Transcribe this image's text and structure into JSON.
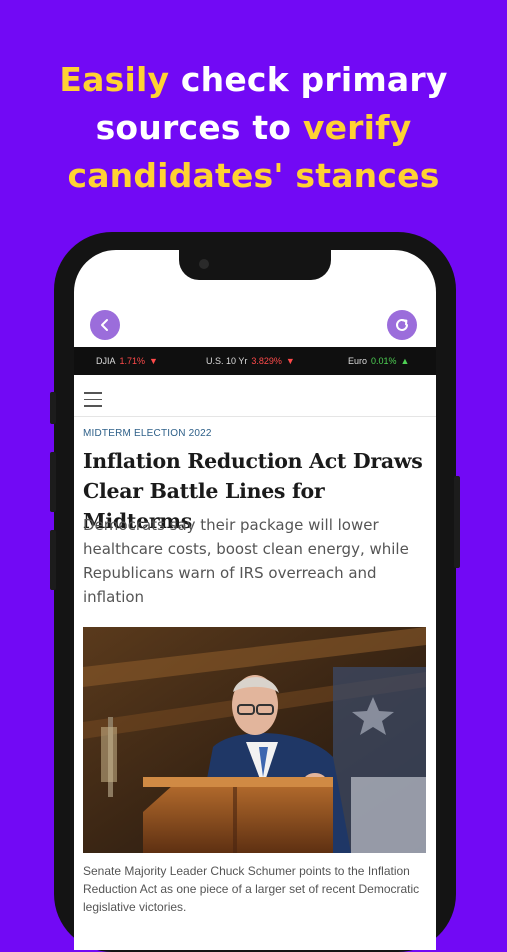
{
  "promo": {
    "line1_accent": "Easily",
    "line1_rest": " check primary",
    "line2_rest": "sources to ",
    "line2_accent": "verify",
    "line3_accent": "candidates' stances",
    "accent_color": "#ffd233",
    "background_color": "#7209f5"
  },
  "nav": {
    "back_icon": "chevron-left-icon",
    "refresh_icon": "refresh-icon"
  },
  "ticker": [
    {
      "label": "DJIA",
      "value": "1.71%",
      "direction": "down"
    },
    {
      "label": "U.S. 10 Yr",
      "value": "3.829%",
      "direction": "down"
    },
    {
      "label": "Euro",
      "value": "0.01%",
      "direction": "up"
    }
  ],
  "article": {
    "kicker": "MIDTERM ELECTION 2022",
    "title": "Inflation Reduction Act Draws Clear Battle Lines for Midterms",
    "dek": "Democrats say their package will lower healthcare costs, boost clean energy, while Republicans warn of IRS overreach and inflation",
    "caption": "Senate Majority Leader Chuck Schumer points to the Inflation Reduction Act as one piece of a larger set of recent Democratic legislative victories."
  },
  "symbols": {
    "down": "▼",
    "up": "▲"
  }
}
